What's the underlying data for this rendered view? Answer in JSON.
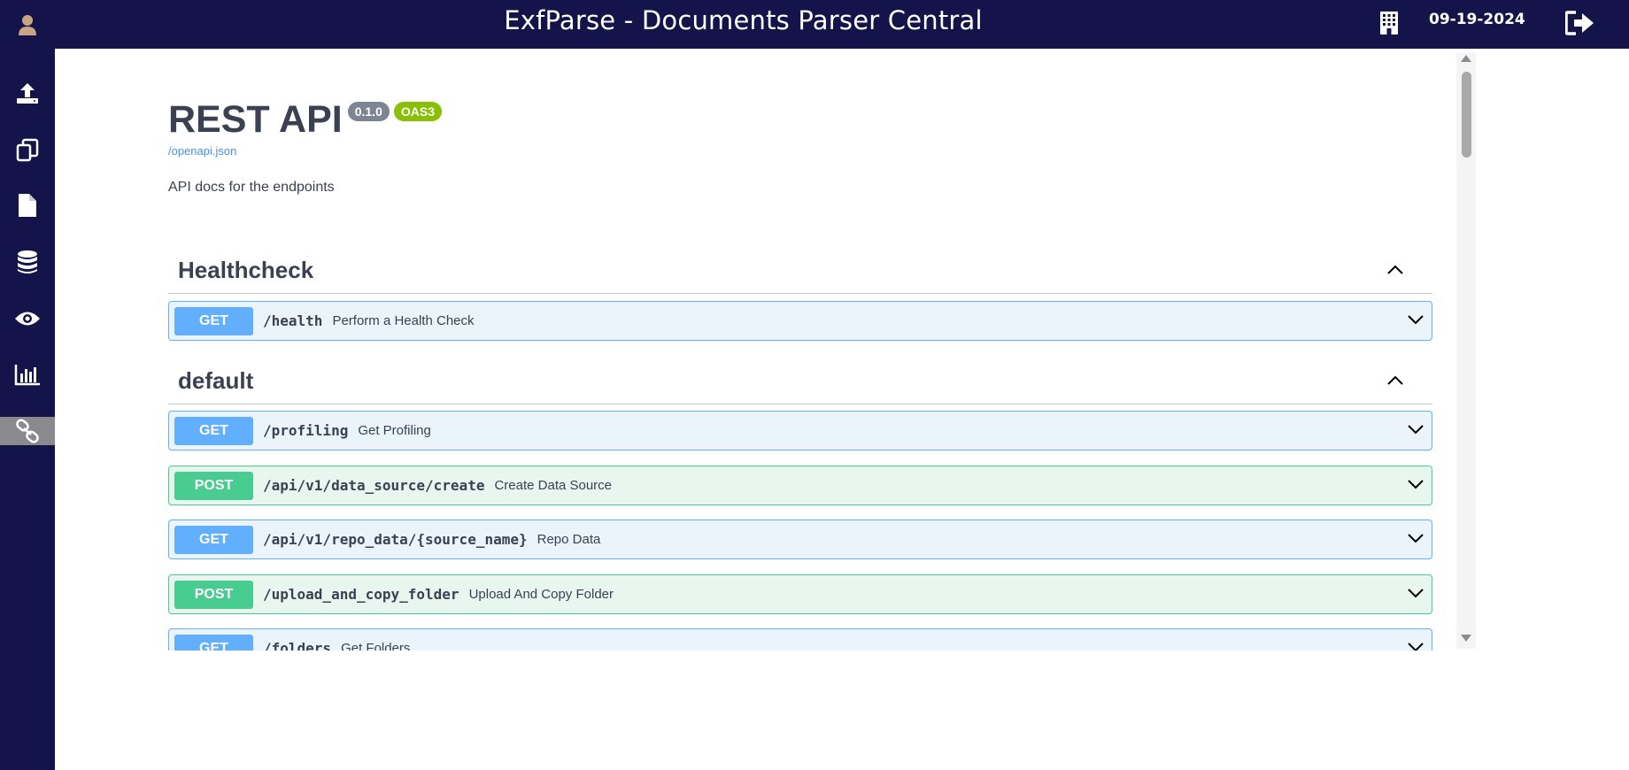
{
  "header": {
    "title": "ExfParse - Documents Parser Central",
    "date": "09-19-2024",
    "building_icon": "building-icon",
    "logout_icon": "logout-icon"
  },
  "sidebar": {
    "avatar_icon": "user-avatar-icon",
    "items": [
      {
        "icon": "upload-icon"
      },
      {
        "icon": "copy-documents-icon"
      },
      {
        "icon": "file-icon"
      },
      {
        "icon": "database-icon"
      },
      {
        "icon": "eye-icon"
      },
      {
        "icon": "bar-chart-icon"
      },
      {
        "icon": "link-icon",
        "active": true
      }
    ]
  },
  "api_info": {
    "title": "REST API",
    "version": "0.1.0",
    "oas_badge": "OAS3",
    "spec_link": "/openapi.json",
    "description": "API docs for the endpoints"
  },
  "tags": [
    {
      "name": "Healthcheck",
      "operations": [
        {
          "method": "GET",
          "path": "/health",
          "summary": "Perform a Health Check"
        }
      ]
    },
    {
      "name": "default",
      "operations": [
        {
          "method": "GET",
          "path": "/profiling",
          "summary": "Get Profiling"
        },
        {
          "method": "POST",
          "path": "/api/v1/data_source/create",
          "summary": "Create Data Source"
        },
        {
          "method": "GET",
          "path": "/api/v1/repo_data/{source_name}",
          "summary": "Repo Data"
        },
        {
          "method": "POST",
          "path": "/upload_and_copy_folder",
          "summary": "Upload And Copy Folder"
        },
        {
          "method": "GET",
          "path": "/folders",
          "summary": "Get Folders"
        }
      ]
    }
  ],
  "colors": {
    "nav_bg": "#14134a",
    "get": "#61affe",
    "post": "#49cc90",
    "version_badge": "#7d8492",
    "oas_badge": "#89bf04",
    "link": "#4990e2"
  }
}
